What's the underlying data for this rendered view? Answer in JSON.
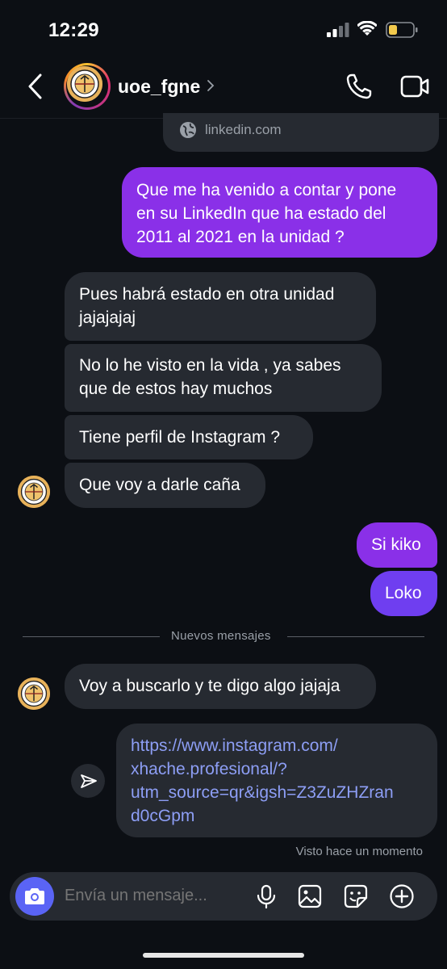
{
  "status": {
    "time": "12:29"
  },
  "header": {
    "username": "uoe_fgne"
  },
  "link_preview": {
    "domain": "linkedin.com"
  },
  "messages": {
    "m1": {
      "lines": [
        "Que me ha venido a contar y pone",
        "en su LinkedIn que ha estado del",
        "2011 al 2021 en la unidad ?"
      ]
    },
    "m2": {
      "lines": [
        "Pues habrá estado en otra unidad",
        "jajajajaj"
      ]
    },
    "m3": {
      "lines": [
        "No lo he visto en la vida , ya sabes",
        "que de estos hay muchos"
      ]
    },
    "m4": {
      "text": "Tiene perfil de Instagram ?"
    },
    "m5": {
      "text": "Que voy a darle caña"
    },
    "m6": {
      "text": "Si kiko"
    },
    "m7": {
      "text": "Loko"
    },
    "m8": {
      "text": "Voy a buscarlo y te digo algo jajaja"
    },
    "m9": {
      "lines": [
        "https://www.instagram.com/",
        "xhache.profesional/?",
        "utm_source=qr&igsh=Z3ZuZHZran",
        "d0cGpm"
      ]
    }
  },
  "divider": {
    "label": "Nuevos mensajes"
  },
  "seen": {
    "label": "Visto hace un momento"
  },
  "composer": {
    "placeholder": "Envía un mensaje..."
  },
  "colors": {
    "outgoing": "#8a30e8",
    "outgoing_alt": "#6f3ef0",
    "incoming": "#262a31",
    "link": "#8d9ef5",
    "camera": "#5a64f5"
  },
  "icons": [
    "back-icon",
    "call-icon",
    "video-icon",
    "globe-icon",
    "share-icon",
    "camera-icon",
    "mic-icon",
    "gallery-icon",
    "sticker-icon",
    "plus-icon"
  ]
}
